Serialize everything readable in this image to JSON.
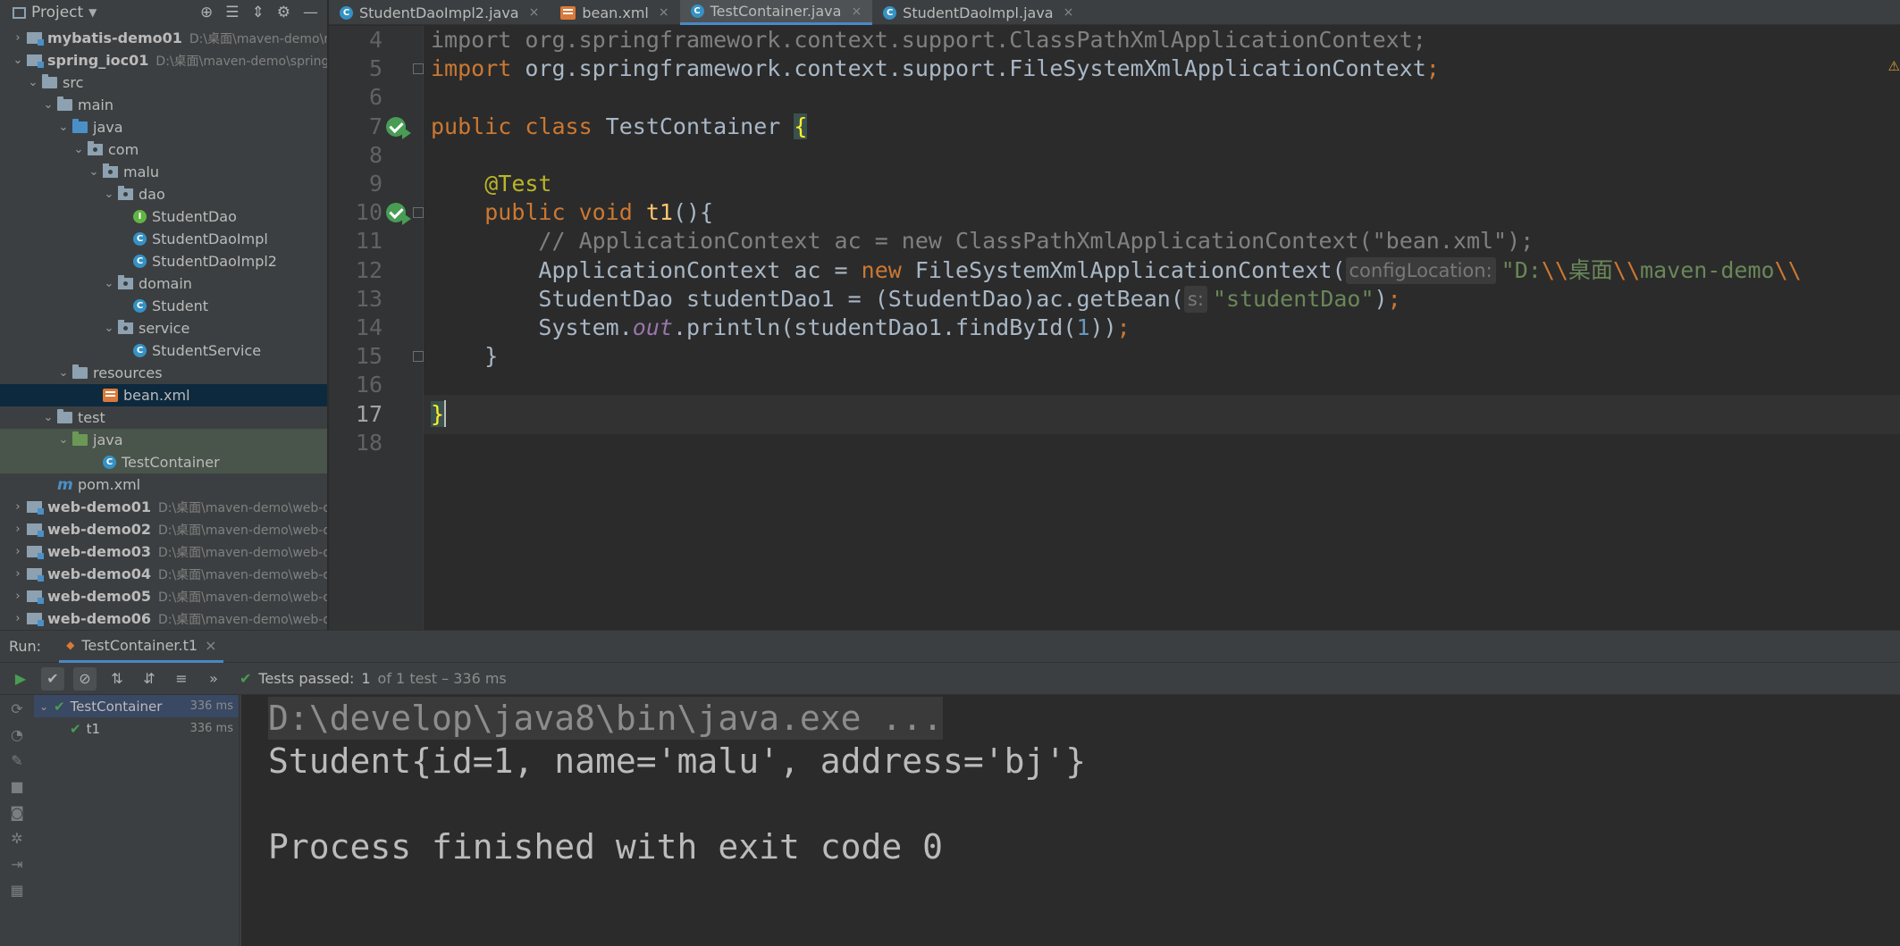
{
  "project": {
    "title": "Project",
    "tree": [
      {
        "label": "mybatis-demo01",
        "path": "D:\\桌面\\maven-demo\\m",
        "level": 0,
        "arrow": "›",
        "icon": "module",
        "bold": true
      },
      {
        "label": "spring_ioc01",
        "path": "D:\\桌面\\maven-demo\\spring_",
        "level": 0,
        "arrow": "⌄",
        "icon": "module",
        "bold": true
      },
      {
        "label": "src",
        "level": 1,
        "arrow": "⌄",
        "icon": "folder"
      },
      {
        "label": "main",
        "level": 2,
        "arrow": "⌄",
        "icon": "folder"
      },
      {
        "label": "java",
        "level": 3,
        "arrow": "⌄",
        "icon": "folder-blue"
      },
      {
        "label": "com",
        "level": 4,
        "arrow": "⌄",
        "icon": "package"
      },
      {
        "label": "malu",
        "level": 5,
        "arrow": "⌄",
        "icon": "package"
      },
      {
        "label": "dao",
        "level": 6,
        "arrow": "⌄",
        "icon": "package"
      },
      {
        "label": "StudentDao",
        "level": 7,
        "arrow": "",
        "icon": "interface"
      },
      {
        "label": "StudentDaoImpl",
        "level": 7,
        "arrow": "",
        "icon": "class"
      },
      {
        "label": "StudentDaoImpl2",
        "level": 7,
        "arrow": "",
        "icon": "class"
      },
      {
        "label": "domain",
        "level": 6,
        "arrow": "⌄",
        "icon": "package"
      },
      {
        "label": "Student",
        "level": 7,
        "arrow": "",
        "icon": "class"
      },
      {
        "label": "service",
        "level": 6,
        "arrow": "⌄",
        "icon": "package"
      },
      {
        "label": "StudentService",
        "level": 7,
        "arrow": "",
        "icon": "class"
      },
      {
        "label": "resources",
        "level": 3,
        "arrow": "⌄",
        "icon": "folder"
      },
      {
        "label": "bean.xml",
        "level": 5,
        "arrow": "",
        "icon": "xml",
        "state": "selected"
      },
      {
        "label": "test",
        "level": 2,
        "arrow": "⌄",
        "icon": "folder"
      },
      {
        "label": "java",
        "level": 3,
        "arrow": "⌄",
        "icon": "folder-green",
        "state": "test-hl"
      },
      {
        "label": "TestContainer",
        "level": 5,
        "arrow": "",
        "icon": "class",
        "state": "test-hl"
      },
      {
        "label": "pom.xml",
        "level": 2,
        "arrow": "",
        "icon": "maven"
      },
      {
        "label": "web-demo01",
        "path": "D:\\桌面\\maven-demo\\web-d",
        "level": 0,
        "arrow": "›",
        "icon": "module",
        "bold": true
      },
      {
        "label": "web-demo02",
        "path": "D:\\桌面\\maven-demo\\web-d",
        "level": 0,
        "arrow": "›",
        "icon": "module",
        "bold": true
      },
      {
        "label": "web-demo03",
        "path": "D:\\桌面\\maven-demo\\web-d",
        "level": 0,
        "arrow": "›",
        "icon": "module",
        "bold": true
      },
      {
        "label": "web-demo04",
        "path": "D:\\桌面\\maven-demo\\web-d",
        "level": 0,
        "arrow": "›",
        "icon": "module",
        "bold": true
      },
      {
        "label": "web-demo05",
        "path": "D:\\桌面\\maven-demo\\web-d",
        "level": 0,
        "arrow": "›",
        "icon": "module",
        "bold": true
      },
      {
        "label": "web-demo06",
        "path": "D:\\桌面\\maven-demo\\web-d",
        "level": 0,
        "arrow": "›",
        "icon": "module",
        "bold": true
      }
    ]
  },
  "tabs": [
    {
      "label": "StudentDaoImpl2.java",
      "icon": "class",
      "close": "×"
    },
    {
      "label": "bean.xml",
      "icon": "xml",
      "close": "×"
    },
    {
      "label": "TestContainer.java",
      "icon": "class",
      "close": "×",
      "active": true
    },
    {
      "label": "StudentDaoImpl.java",
      "icon": "class",
      "close": "×"
    }
  ],
  "editor": {
    "lines": [
      {
        "n": "4",
        "tokens": [
          {
            "t": "import org.springframework.context.support.ClassPathXmlApplicationContext;",
            "c": "cmt"
          }
        ]
      },
      {
        "n": "5",
        "tokens": [
          {
            "t": "import ",
            "c": "kw"
          },
          {
            "t": "org.springframework.context.support.FileSystemXmlApplicationContext"
          },
          {
            "t": ";",
            "c": "kw"
          }
        ]
      },
      {
        "n": "6",
        "tokens": []
      },
      {
        "n": "7",
        "tokens": [
          {
            "t": "public class ",
            "c": "kw"
          },
          {
            "t": "TestContainer "
          },
          {
            "t": "{",
            "c": "brace"
          }
        ]
      },
      {
        "n": "8",
        "tokens": []
      },
      {
        "n": "9",
        "tokens": [
          {
            "t": "    "
          },
          {
            "t": "@Test",
            "c": "ann"
          }
        ]
      },
      {
        "n": "10",
        "tokens": [
          {
            "t": "    "
          },
          {
            "t": "public void ",
            "c": "kw"
          },
          {
            "t": "t1",
            "c": "fn"
          },
          {
            "t": "(){"
          }
        ]
      },
      {
        "n": "11",
        "tokens": [
          {
            "t": "        "
          },
          {
            "t": "// ApplicationContext ac = new ClassPathXmlApplicationContext(\"bean.xml\");",
            "c": "cmt"
          }
        ]
      },
      {
        "n": "12",
        "tokens": [
          {
            "t": "        ApplicationContext ac = "
          },
          {
            "t": "new ",
            "c": "kw"
          },
          {
            "t": "FileSystemXmlApplicationContext("
          },
          {
            "t": "configLocation:",
            "c": "hint"
          },
          {
            "t": "\"D:",
            "c": "str"
          },
          {
            "t": "\\\\",
            "c": "kw"
          },
          {
            "t": "桌面",
            "c": "str"
          },
          {
            "t": "\\\\",
            "c": "kw"
          },
          {
            "t": "maven-demo",
            "c": "str"
          },
          {
            "t": "\\\\",
            "c": "kw"
          }
        ]
      },
      {
        "n": "13",
        "tokens": [
          {
            "t": "        StudentDao studentDao1 = (StudentDao)ac.getBean("
          },
          {
            "t": "s:",
            "c": "hint"
          },
          {
            "t": "\"studentDao\"",
            "c": "str"
          },
          {
            "t": ")"
          },
          {
            "t": ";",
            "c": "kw"
          }
        ]
      },
      {
        "n": "14",
        "tokens": [
          {
            "t": "        System."
          },
          {
            "t": "out",
            "c": "fld"
          },
          {
            "t": ".println(studentDao1.findById("
          },
          {
            "t": "1",
            "c": "num"
          },
          {
            "t": "))"
          },
          {
            "t": ";",
            "c": "kw"
          }
        ]
      },
      {
        "n": "15",
        "tokens": [
          {
            "t": "    }"
          }
        ]
      },
      {
        "n": "16",
        "tokens": []
      },
      {
        "n": "17",
        "tokens": [
          {
            "t": "}",
            "c": "brace"
          },
          {
            "t": "",
            "c": "caret"
          }
        ],
        "current": true
      },
      {
        "n": "18",
        "tokens": []
      }
    ],
    "warning": "⚠"
  },
  "run": {
    "label": "Run:",
    "tab": "TestContainer.t1",
    "tab_close": "×",
    "status_prefix": "Tests passed:",
    "status_count": "1",
    "status_suffix": "of 1 test – 336 ms",
    "more": "»",
    "tests": [
      {
        "label": "TestContainer",
        "time": "336 ms",
        "chev": "⌄",
        "level": 0
      },
      {
        "label": "t1",
        "time": "336 ms",
        "chev": "",
        "level": 1
      }
    ],
    "console": [
      {
        "text": "D:\\develop\\java8\\bin\\java.exe ...",
        "kind": "cmd"
      },
      {
        "text": "Student{id=1, name='malu', address='bj'}",
        "kind": "out"
      },
      {
        "text": "",
        "kind": "out"
      },
      {
        "text": "Process finished with exit code 0",
        "kind": "out"
      }
    ]
  },
  "colors": {
    "accent": "#4a88c7",
    "pass": "#499c54",
    "keyword": "#cc7832",
    "string": "#6a8759"
  }
}
